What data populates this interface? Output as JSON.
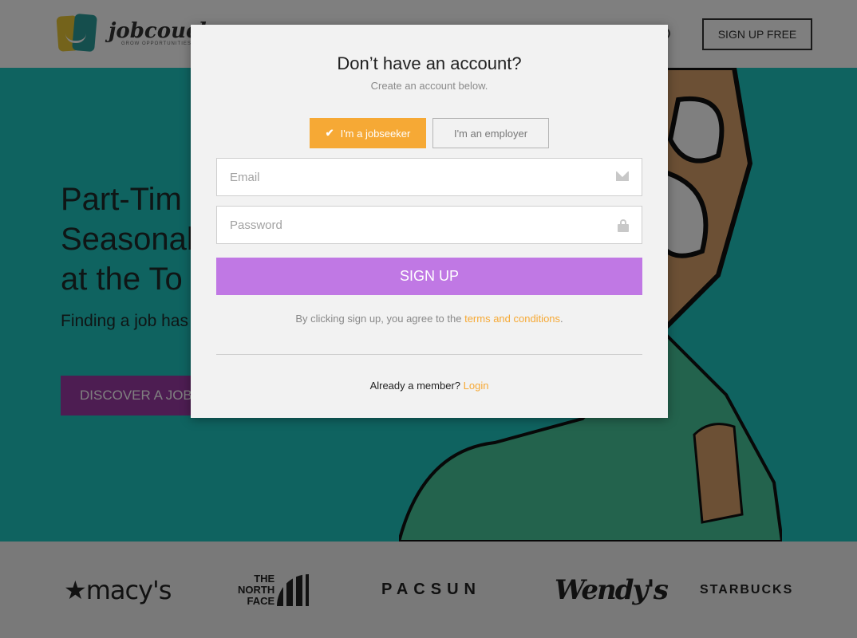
{
  "header": {
    "logo_word": "jobcouch",
    "logo_tagline": "GROW OPPORTUNITIES",
    "signup_label": "SIGN UP FREE"
  },
  "hero": {
    "title_lines": [
      "Part-Tim",
      "Seasonal",
      "at the To"
    ],
    "subtitle": "Finding a job has",
    "cta_label": "DISCOVER A JOB",
    "color": "#1fc6c0"
  },
  "brands": {
    "macys": "★macy's",
    "tnf_lines": [
      "THE",
      "NORTH",
      "FACE"
    ],
    "pacsun": "PACSUN",
    "wendys": "Wendy's",
    "starbucks": "STARBUCKS"
  },
  "modal": {
    "title": "Don’t have an account?",
    "subtitle": "Create an account below.",
    "role_jobseeker": "I'm a jobseeker",
    "role_employer": "I'm an employer",
    "selected_role": "jobseeker",
    "email_placeholder": "Email",
    "email_icon": "envelope-icon",
    "password_placeholder": "Password",
    "password_icon": "lock-icon",
    "signup_label": "SIGN UP",
    "terms_prefix": "By clicking sign up, you agree to the ",
    "terms_link": "terms and conditions",
    "terms_suffix": ".",
    "member_prefix": "Already a member? ",
    "login_link": "Login"
  },
  "colors": {
    "accent_orange": "#f6a935",
    "signup_purple": "#c078e4",
    "cta_purple": "#9b3ba5"
  }
}
